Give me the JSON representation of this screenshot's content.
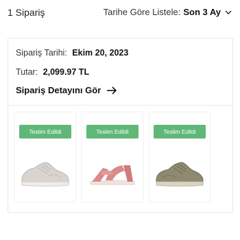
{
  "header": {
    "order_count": "1 Sipariş",
    "sort_label": "Tarihe Göre Listele:",
    "sort_value": "Son 3 Ay"
  },
  "order": {
    "date_label": "Sipariş Tarihi:",
    "date_value": "Ekim 20, 2023",
    "total_label": "Tutar:",
    "total_value": "2,099.97 TL",
    "detail_link": "Sipariş Detayını Gör",
    "items": [
      {
        "status": "Teslim Edildi",
        "product_icon": "sneaker-white-icon",
        "color": "#d9d4cf"
      },
      {
        "status": "Teslim Edildi",
        "product_icon": "sandal-pink-icon",
        "color": "#d98a8a"
      },
      {
        "status": "Teslim Edildi",
        "product_icon": "sneaker-khaki-icon",
        "color": "#8f8a6f"
      }
    ]
  },
  "colors": {
    "status_green": "#5fb878",
    "border": "#e6e6e6"
  }
}
